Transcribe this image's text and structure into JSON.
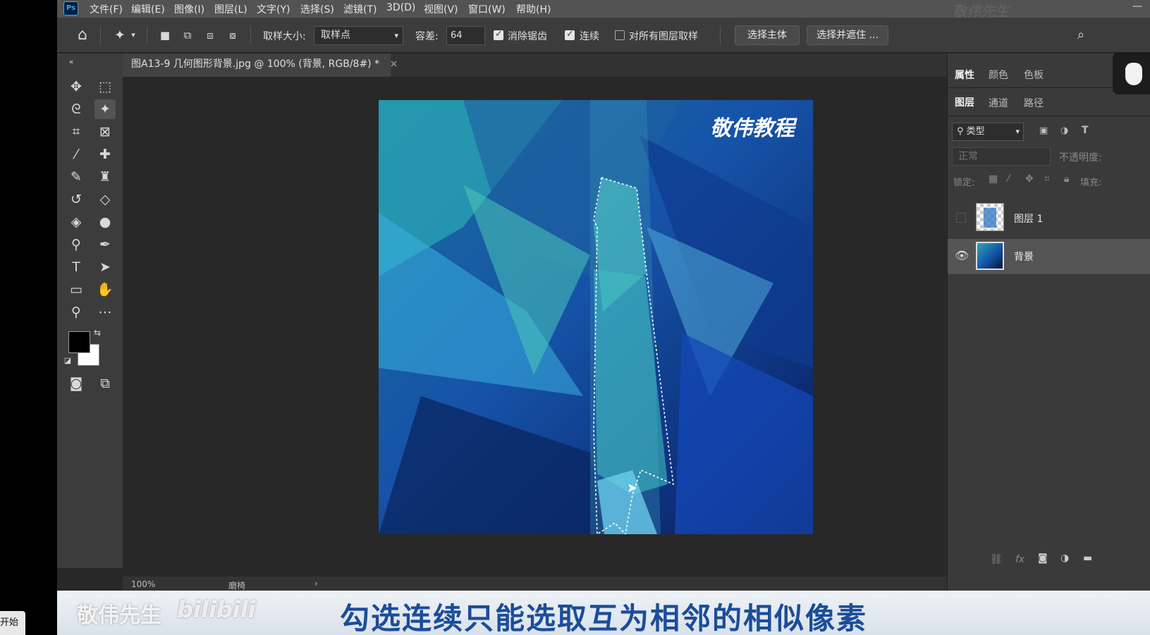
{
  "start_chip": "开始",
  "menubar": {
    "logo": "Ps",
    "items": [
      "文件(F)",
      "编辑(E)",
      "图像(I)",
      "图层(L)",
      "文字(Y)",
      "选择(S)",
      "滤镜(T)",
      "3D(D)",
      "视图(V)",
      "窗口(W)",
      "帮助(H)"
    ],
    "watermark": "敬伟先生"
  },
  "options": {
    "sample_size_label": "取样大小:",
    "sample_size_value": "取样点",
    "tolerance_label": "容差:",
    "tolerance_value": "64",
    "antialias_label": "消除锯齿",
    "antialias_checked": true,
    "contiguous_label": "连续",
    "contiguous_checked": true,
    "sample_all_label": "对所有图层取样",
    "sample_all_checked": false,
    "select_subject": "选择主体",
    "select_mask": "选择并遮住 ..."
  },
  "document": {
    "tab_title": "图A13-9 几何图形背景.jpg @ 100% (背景, RGB/8#) *",
    "canvas_text": "敬伟教程",
    "zoom": "100%",
    "status_text": "磨椅"
  },
  "panels": {
    "top_tabs": [
      "属性",
      "颜色",
      "色板"
    ],
    "layer_tabs": [
      "图层",
      "通道",
      "路径"
    ],
    "filter_kind": "类型",
    "blend_mode": "正常",
    "opacity_label": "不透明度:",
    "lock_label": "锁定:",
    "fill_label": "填充:",
    "layers": [
      {
        "name": "图层 1",
        "visible": false
      },
      {
        "name": "背景",
        "visible": true,
        "selected": true
      }
    ]
  },
  "subtitle": {
    "watermark": "敬伟先生",
    "watermark_logo": "bilibili",
    "text": "勾选连续只能选取互为相邻的相似像素"
  },
  "colors": {
    "ps_bg": "#282828",
    "panel": "#3a3a3a",
    "subtitle_text": "#1b4d99"
  }
}
